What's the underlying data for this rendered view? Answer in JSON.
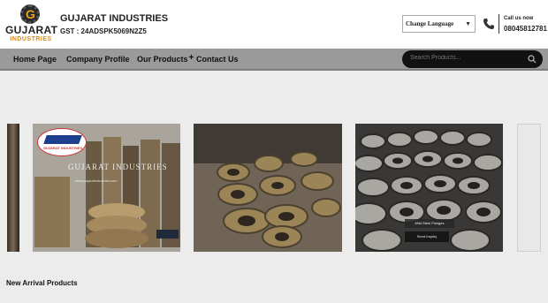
{
  "brand": {
    "logo_word1": "GUJARAT",
    "logo_word2": "INDUSTRIES",
    "company_name": "GUJARAT INDUSTRIES",
    "gst": "GST : 24ADSPK5069N2Z5"
  },
  "language": {
    "selected": "Change Language"
  },
  "contact": {
    "call_label": "Call us now",
    "phone": "08045812781"
  },
  "nav": {
    "items": [
      "Home Page",
      "Company Profile",
      "Our Products",
      "Contact Us"
    ],
    "plus": "+"
  },
  "search": {
    "placeholder": "Search Products..."
  },
  "slider": {
    "badge_text": "GUJARAT INDUSTRIES",
    "watermark_title": "GUJARAT INDUSTRIES",
    "watermark_url": "www.gujaratindustries.com",
    "caption": "Mild Steel Flanges",
    "enquiry": "Send Inquiry"
  },
  "sections": {
    "new_arrivals": "New Arrival Products"
  },
  "colors": {
    "navbar": "#9a9a9a",
    "accent": "#d98b1a"
  }
}
